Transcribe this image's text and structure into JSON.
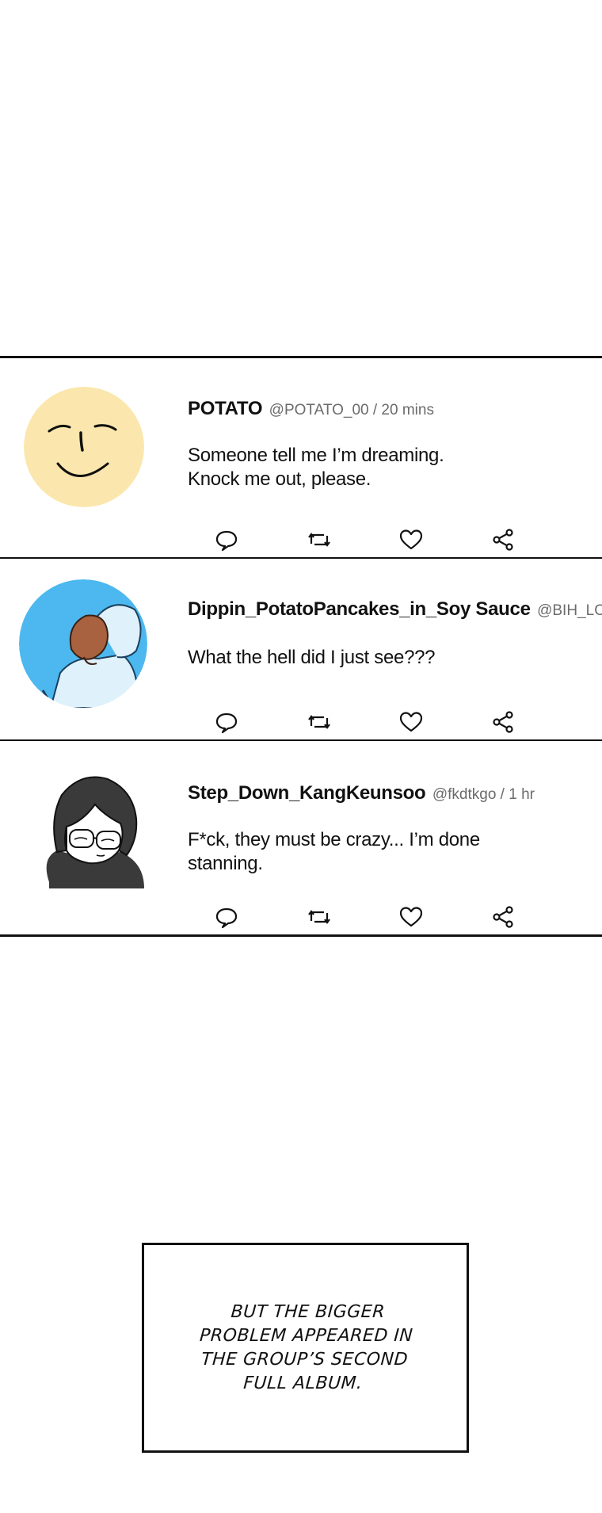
{
  "posts": [
    {
      "username": "POTATO",
      "handle": "@POTATO_00 / 20 mins",
      "lines": [
        "Someone tell me I’m dreaming.",
        "Knock me out, please."
      ],
      "avatar_icon": "smiley-face-avatar"
    },
    {
      "username": "Dippin_PotatoPancakes_in_Soy Sauce",
      "handle": "@BIH_LOV",
      "lines": [
        "What the hell did I just see???"
      ],
      "avatar_icon": "idol-back-view-avatar"
    },
    {
      "username": "Step_Down_KangKeunsoo",
      "handle": "@fkdtkgo / 1 hr",
      "lines": [
        "F*ck, they must be crazy... I’m done",
        "stanning."
      ],
      "avatar_icon": "man-with-glasses-avatar"
    }
  ],
  "action_icons": [
    "reply-icon",
    "retweet-icon",
    "like-icon",
    "share-icon"
  ],
  "caption": {
    "lines": [
      "BUT THE BIGGER",
      "PROBLEM APPEARED IN",
      "THE GROUP’S SECOND",
      "FULL ALBUM."
    ]
  },
  "colors": {
    "avatar1_bg": "#fbe7ad",
    "avatar2_bg": "#4cb8ef",
    "handle": "#6b6b6b",
    "border": "#111111"
  }
}
